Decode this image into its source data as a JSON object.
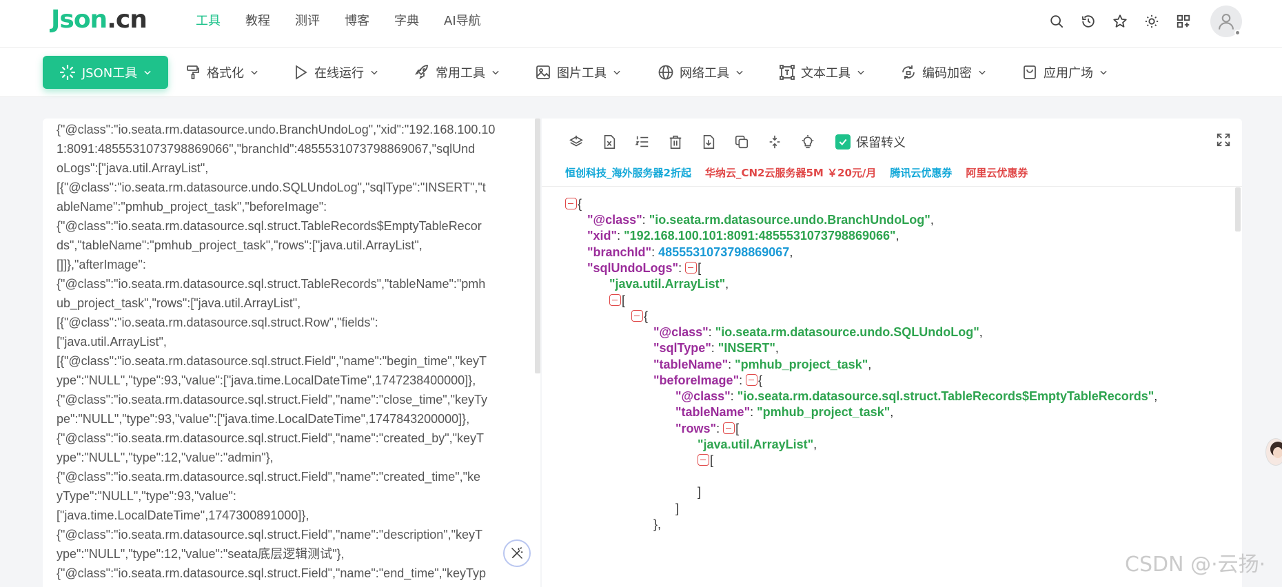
{
  "logo": {
    "part1": "Json",
    "part2": ".cn"
  },
  "top_nav": [
    "工具",
    "教程",
    "测评",
    "博客",
    "字典",
    "AI导航"
  ],
  "top_icons": [
    "search-icon",
    "history-icon",
    "star-icon",
    "theme-sun-icon",
    "apps-grid-icon",
    "user-avatar-icon"
  ],
  "toolbar": {
    "items": [
      "JSON工具",
      "格式化",
      "在线运行",
      "常用工具",
      "图片工具",
      "网络工具",
      "文本工具",
      "编码加密",
      "应用广场"
    ],
    "active_color": "#1ec28b"
  },
  "left_text_lines": [
    "{\"@class\":\"io.seata.rm.datasource.undo.BranchUndoLog\",\"xid\":\"192.168.100.10",
    "1:8091:4855531073798869066\",\"branchId\":4855531073798869067,\"sqlUnd",
    "oLogs\":[\"java.util.ArrayList\",",
    "[{\"@class\":\"io.seata.rm.datasource.undo.SQLUndoLog\",\"sqlType\":\"INSERT\",\"t",
    "ableName\":\"pmhub_project_task\",\"beforeImage\":",
    "{\"@class\":\"io.seata.rm.datasource.sql.struct.TableRecords$EmptyTableRecor",
    "ds\",\"tableName\":\"pmhub_project_task\",\"rows\":[\"java.util.ArrayList\",",
    "[]]},\"afterImage\":",
    "{\"@class\":\"io.seata.rm.datasource.sql.struct.TableRecords\",\"tableName\":\"pmh",
    "ub_project_task\",\"rows\":[\"java.util.ArrayList\",",
    "[{\"@class\":\"io.seata.rm.datasource.sql.struct.Row\",\"fields\":",
    "[\"java.util.ArrayList\",",
    "[{\"@class\":\"io.seata.rm.datasource.sql.struct.Field\",\"name\":\"begin_time\",\"keyT",
    "ype\":\"NULL\",\"type\":93,\"value\":[\"java.time.LocalDateTime\",1747238400000]},",
    "{\"@class\":\"io.seata.rm.datasource.sql.struct.Field\",\"name\":\"close_time\",\"keyTy",
    "pe\":\"NULL\",\"type\":93,\"value\":[\"java.time.LocalDateTime\",1747843200000]},",
    "{\"@class\":\"io.seata.rm.datasource.sql.struct.Field\",\"name\":\"created_by\",\"keyT",
    "ype\":\"NULL\",\"type\":12,\"value\":\"admin\"},",
    "{\"@class\":\"io.seata.rm.datasource.sql.struct.Field\",\"name\":\"created_time\",\"ke",
    "yType\":\"NULL\",\"type\":93,\"value\":",
    "[\"java.time.LocalDateTime\",1747300891000]},",
    "{\"@class\":\"io.seata.rm.datasource.sql.struct.Field\",\"name\":\"description\",\"keyT",
    "ype\":\"NULL\",\"type\":12,\"value\":\"seata底层逻辑测试\"},",
    "{\"@class\":\"io.seata.rm.datasource.sql.struct.Field\",\"name\":\"end_time\",\"keyTyp"
  ],
  "right_toolbar": {
    "icons": [
      "layers-icon",
      "excel-icon",
      "ordered-list-icon",
      "trash-icon",
      "download-icon",
      "copy-icon",
      "compress-icon",
      "bulb-icon"
    ],
    "keep_escape_label": "保留转义",
    "keep_escape_checked": true
  },
  "ads": [
    "恒创科技_海外服务器2折起",
    "华纳云_CN2云服务器5M ￥20元/月",
    "腾讯云优惠券",
    "阿里云优惠券"
  ],
  "tree": {
    "k_class": "\"@class\"",
    "k_xid": "\"xid\"",
    "k_branchId": "\"branchId\"",
    "k_sqlUndoLogs": "\"sqlUndoLogs\"",
    "k_sqlType": "\"sqlType\"",
    "k_tableName": "\"tableName\"",
    "k_beforeImage": "\"beforeImage\"",
    "k_rows": "\"rows\"",
    "v_branchUndoLog": "\"io.seata.rm.datasource.undo.BranchUndoLog\"",
    "v_xid": "\"192.168.100.101:8091:4855531073798869066\"",
    "v_branchId": "4855531073798869067",
    "v_arraylist": "\"java.util.ArrayList\"",
    "v_sqlUndoLog": "\"io.seata.rm.datasource.undo.SQLUndoLog\"",
    "v_insert": "\"INSERT\"",
    "v_table": "\"pmhub_project_task\"",
    "v_emptyRecords": "\"io.seata.rm.datasource.sql.struct.TableRecords$EmptyTableRecords\""
  },
  "watermark": "CSDN @·云扬·"
}
